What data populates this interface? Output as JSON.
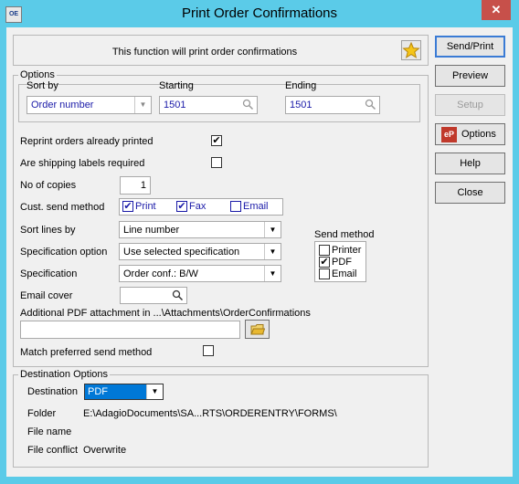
{
  "window": {
    "title": "Print Order Confirmations",
    "app_icon_text": "OE",
    "close_icon": "close-icon"
  },
  "banner": {
    "text": "This function will print order confirmations",
    "icon": "star-icon"
  },
  "buttons": {
    "send_print": "Send/Print",
    "preview": "Preview",
    "setup": "Setup",
    "options": "Options",
    "options_icon_text": "eP",
    "help": "Help",
    "close": "Close"
  },
  "options_group": {
    "title": "Options",
    "sort_by_label": "Sort by",
    "sort_by_value": "Order number",
    "starting_label": "Starting",
    "starting_value": "1501",
    "ending_label": "Ending",
    "ending_value": "1501"
  },
  "reprint": {
    "label": "Reprint orders already printed",
    "checked": true
  },
  "shipping_labels": {
    "label": "Are shipping labels required",
    "checked": false
  },
  "copies": {
    "label": "No of copies",
    "value": "1"
  },
  "cust_send": {
    "label": "Cust. send method",
    "print": "Print",
    "fax": "Fax",
    "email": "Email",
    "print_checked": true,
    "fax_checked": true,
    "email_checked": false
  },
  "sort_lines": {
    "label": "Sort lines by",
    "value": "Line number"
  },
  "spec_option": {
    "label": "Specification option",
    "value": "Use selected specification"
  },
  "specification": {
    "label": "Specification",
    "value": "Order conf.: B/W"
  },
  "email_cover": {
    "label": "Email cover",
    "value": ""
  },
  "pdf_attachment": {
    "label": "Additional PDF attachment in ...\\Attachments\\OrderConfirmations",
    "value": ""
  },
  "send_method": {
    "title": "Send method",
    "printer": "Printer",
    "pdf": "PDF",
    "email": "Email",
    "printer_checked": false,
    "pdf_checked": true,
    "email_checked": false
  },
  "match_preferred": {
    "label": "Match preferred send method",
    "checked": false
  },
  "destination": {
    "title": "Destination Options",
    "destination_label": "Destination",
    "destination_value": "PDF",
    "folder_label": "Folder",
    "folder_value": "E:\\AdagioDocuments\\SA...RTS\\ORDERENTRY\\FORMS\\",
    "file_name_label": "File name",
    "file_conflict_label": "File conflict",
    "file_conflict_value": "Overwrite"
  },
  "colors": {
    "titlebar": "#5bcbe8",
    "close_button": "#c7504a",
    "selected": "#0078d7"
  }
}
